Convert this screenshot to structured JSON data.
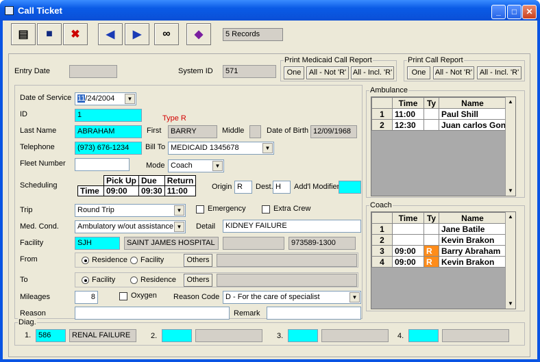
{
  "window": {
    "title": "Call Ticket",
    "minimize": "_",
    "maximize": "□",
    "close": "✕"
  },
  "toolbar": {
    "records": "5 Records"
  },
  "entry": {
    "entry_date_label": "Entry Date",
    "entry_date": "",
    "system_id_label": "System ID",
    "system_id": "571"
  },
  "medicaid_report": {
    "title": "Print Medicaid Call Report",
    "one": "One",
    "all_not_r": "All - Not 'R'",
    "all_incl_r": "All - Incl. 'R'"
  },
  "call_report": {
    "title": "Print Call Report",
    "one": "One",
    "all_not_r": "All - Not 'R'",
    "all_incl_r": "All - Incl. 'R'"
  },
  "form": {
    "dos_label": "Date of Service",
    "dos_selected": "11",
    "dos_rest": "/24/2004",
    "id_label": "ID",
    "id": "1",
    "type_r": "Type R",
    "last_name_label": "Last Name",
    "last_name": "ABRAHAM",
    "first_label": "First",
    "first": "BARRY",
    "middle_label": "Middle",
    "middle": "",
    "dob_label": "Date of Birth",
    "dob": "12/09/1968",
    "tel_label": "Telephone",
    "tel": "(973) 676-1234",
    "bill_to_label": "Bill To",
    "bill_to": "MEDICAID 1345678",
    "fleet_label": "Fleet Number",
    "fleet": "",
    "mode_label": "Mode",
    "mode": "Coach",
    "sched_label": "Scheduling",
    "sched": {
      "h_pickup": "Pick Up",
      "h_due": "Due",
      "h_return": "Return",
      "time": "Time",
      "pickup": "09:00",
      "due": "09:30",
      "return": "11:00"
    },
    "origin_label": "Origin",
    "origin": "R",
    "dest_label": "Dest.",
    "dest": "H",
    "addl_label": "Add'l Modifier",
    "addl": "",
    "trip_label": "Trip",
    "trip": "Round Trip",
    "emergency": "Emergency",
    "extra_crew": "Extra Crew",
    "medcond_label": "Med. Cond.",
    "medcond": "Ambulatory w/out assistance",
    "detail_label": "Detail",
    "detail": "KIDNEY FAILURE",
    "facility_label": "Facility",
    "facility_code": "SJH",
    "facility_name": "SAINT JAMES HOSPITAL",
    "facility_blank": "",
    "facility_phone": "973589-1300",
    "from_label": "From",
    "from_opt1": "Residence",
    "from_opt2": "Facility",
    "others": "Others",
    "to_label": "To",
    "to_opt1": "Facility",
    "to_opt2": "Residence",
    "mileages_label": "Mileages",
    "mileages": "8",
    "oxygen": "Oxygen",
    "reason_code_label": "Reason Code",
    "reason_code": "D - For the care of specialist",
    "reason_label": "Reason",
    "reason": "",
    "remark_label": "Remark",
    "remark": ""
  },
  "diag": {
    "title": "Diag.",
    "n1": "1.",
    "code1": "586",
    "desc1": "RENAL FAILURE",
    "n2": "2.",
    "n3": "3.",
    "n4": "4."
  },
  "ambulance": {
    "title": "Ambulance",
    "headers": [
      "Time",
      "Ty",
      "Name"
    ],
    "rows": [
      {
        "n": "1",
        "time": "11:00",
        "ty": "",
        "name": "Paul Shill"
      },
      {
        "n": "2",
        "time": "12:30",
        "ty": "",
        "name": "Juan carlos Gon"
      }
    ]
  },
  "coach": {
    "title": "Coach",
    "headers": [
      "Time",
      "Ty",
      "Name"
    ],
    "rows": [
      {
        "n": "1",
        "time": "",
        "ty": "",
        "name": "Jane Batile"
      },
      {
        "n": "2",
        "time": "",
        "ty": "",
        "name": "Kevin Brakon"
      },
      {
        "n": "3",
        "time": "09:00",
        "ty": "R",
        "name": "Barry Abraham"
      },
      {
        "n": "4",
        "time": "09:00",
        "ty": "R",
        "name": "Kevin Brakon"
      }
    ]
  },
  "icons": [
    "notepad-icon",
    "save-icon",
    "delete-icon",
    "back-arrow-icon",
    "forward-arrow-icon",
    "binoculars-icon",
    "help-book-icon"
  ],
  "colors": {
    "field_cyan": "#00ffff",
    "type_r_orange": "#ff8c1a",
    "type_r_label": "#d40000"
  }
}
